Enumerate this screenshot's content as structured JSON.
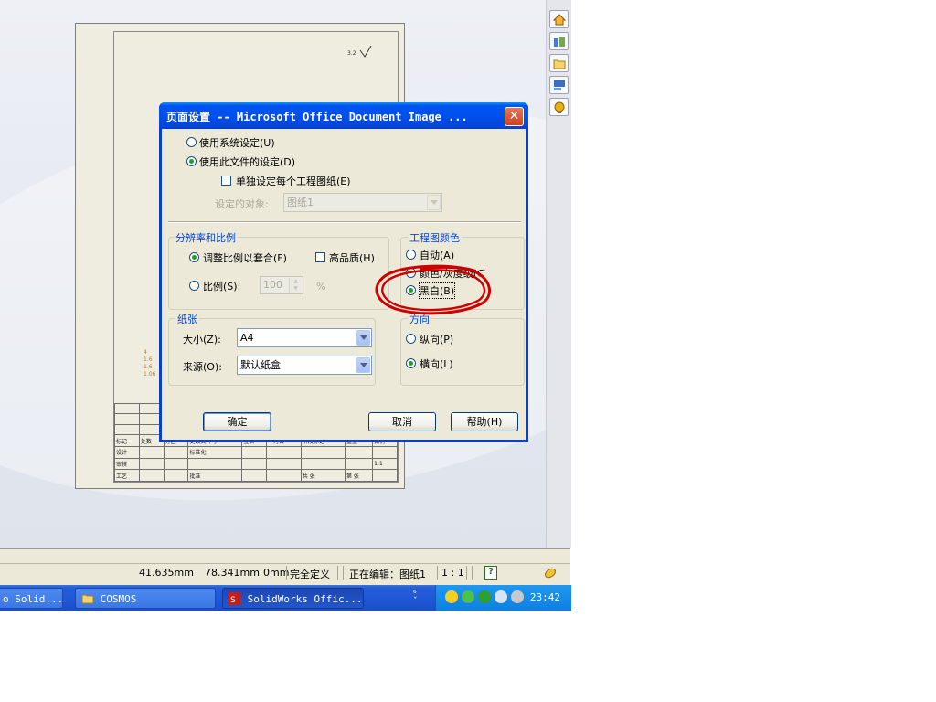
{
  "drawing": {
    "roughness_mark": "3.2",
    "dim_marks": [
      "4",
      "1.6",
      "1.6",
      "1.06"
    ],
    "title_block_rows": [
      [
        "标记",
        "处数",
        "分区",
        "更改文件号",
        "签名",
        "年月日",
        "阶段标记",
        "重量",
        "比例"
      ],
      [
        "设计",
        "",
        "",
        "标准化",
        "",
        "",
        "",
        "",
        ""
      ],
      [
        "审核",
        "",
        "",
        "",
        "",
        "",
        "",
        "",
        "1:1"
      ],
      [
        "工艺",
        "",
        "",
        "批准",
        "",
        "",
        "共 张",
        "第 张",
        ""
      ]
    ]
  },
  "taskpane": {
    "buttons": [
      "home-icon",
      "design-library-icon",
      "file-explorer-icon",
      "view-palette-icon",
      "appearances-icon"
    ]
  },
  "statusbar": {
    "x": "41.635mm",
    "y": "78.341mm",
    "z": "0mm",
    "state": "完全定义",
    "editing": "正在编辑：图纸1",
    "scale": "1 : 1",
    "help": "?"
  },
  "taskbar": {
    "tasks": [
      {
        "label": "o Solid...",
        "active": false
      },
      {
        "label": "COSMOS",
        "active": false
      },
      {
        "label": "SolidWorks Offic...",
        "active": true
      }
    ],
    "clock": "23:42"
  },
  "dialog": {
    "title": "页面设置 -- Microsoft Office Document Image ...",
    "close": "✕",
    "use_system": "使用系统设定(U)",
    "use_document": "使用此文件的设定(D)",
    "per_sheet": "单独设定每个工程图纸(E)",
    "target_label": "设定的对象:",
    "target_value": "图纸1",
    "resolution_group": "分辨率和比例",
    "fit_scale": "调整比例以套合(F)",
    "high_quality": "高品质(H)",
    "scale_label": "比例(S):",
    "scale_value": "100",
    "percent": "%",
    "color_group": "工程图颜色",
    "color_auto": "自动(A)",
    "color_gray": "颜色/灰度级(C)",
    "color_bw": "黑白(B)",
    "paper_group": "纸张",
    "size_label": "大小(Z):",
    "size_value": "A4",
    "source_label": "来源(O):",
    "source_value": "默认纸盒",
    "orientation_group": "方向",
    "portrait": "纵向(P)",
    "landscape": "横向(L)",
    "ok": "确定",
    "cancel": "取消",
    "help": "帮助(H)"
  },
  "colors": {
    "annotation_red": "#cc0000",
    "group_title": "#0046d5",
    "xp_blue": "#0053ee"
  }
}
